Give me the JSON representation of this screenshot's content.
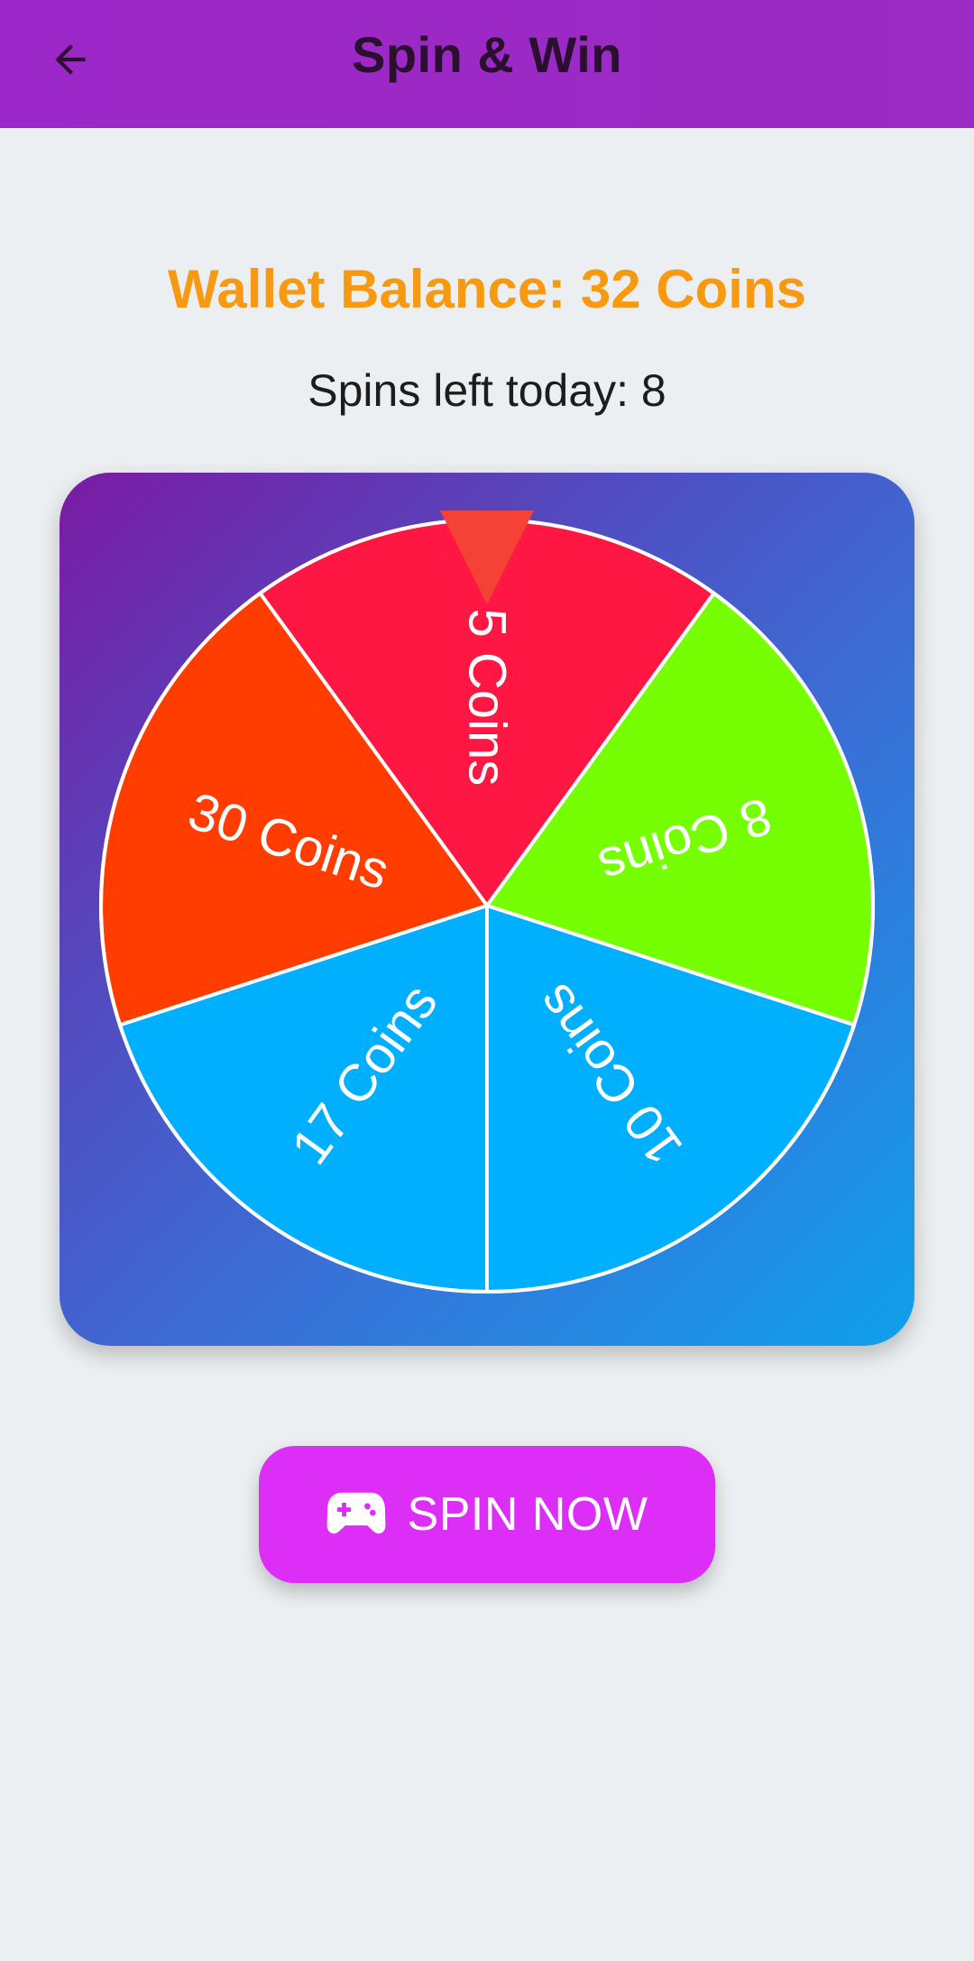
{
  "app_bar": {
    "title": "Spin & Win",
    "back_icon": "arrow-back-icon",
    "background": "#9c27c8"
  },
  "wallet": {
    "text": "Wallet Balance: 32 Coins",
    "color": "#f79a12"
  },
  "spins": {
    "text": "Spins left today: 8"
  },
  "wheel": {
    "pointer_icon": "triangle-pointer-icon",
    "pointer_color": "#f44336",
    "segments": [
      {
        "label": "5 Coins",
        "color": "#ff1744"
      },
      {
        "label": "8 Coins",
        "color": "#76ff03"
      },
      {
        "label": "10 Coins",
        "color": "#00b0ff"
      },
      {
        "label": "17 Coins",
        "color": "#00b0ff"
      },
      {
        "label": "30 Coins",
        "color": "#ff3d00"
      }
    ]
  },
  "spin_button": {
    "label": "SPIN NOW",
    "icon": "gamepad-icon",
    "color": "#dc2ef6"
  }
}
